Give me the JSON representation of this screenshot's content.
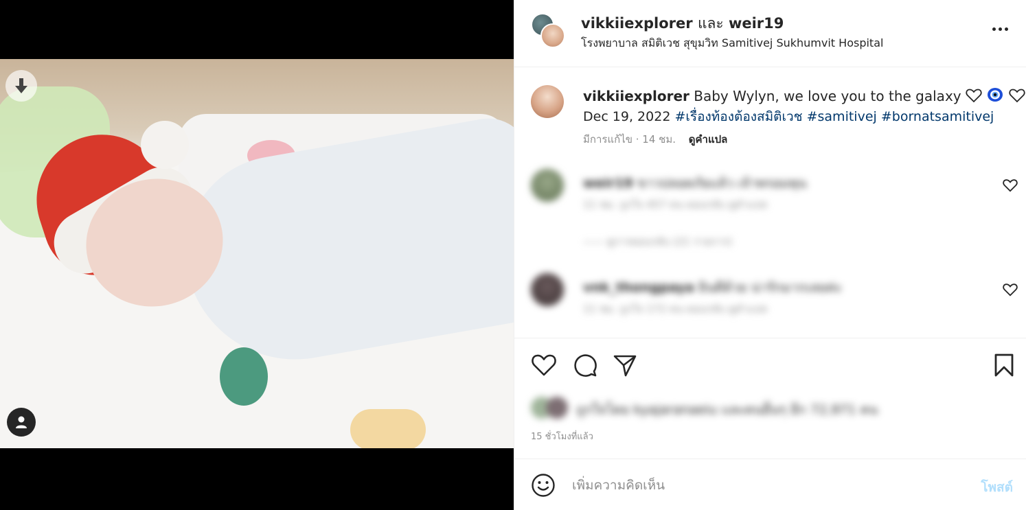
{
  "header": {
    "user1": "vikkiiexplorer",
    "joiner": "และ",
    "user2": "weir19",
    "location": "โรงพยาบาล สมิติเวช สุขุมวิท Samitivej Sukhumvit Hospital",
    "more_icon": "more-horizontal-icon"
  },
  "media": {
    "download_icon": "arrow-down-icon",
    "tagged_users_icon": "user-icon"
  },
  "caption": {
    "username": "vikkiiexplorer",
    "text": "Baby Wylyn, we love you to the galaxy",
    "emojis": [
      "white-heart",
      "blue-evil-eye",
      "white-heart"
    ],
    "date": "Dec 19, 2022",
    "hashtags": [
      "#เรื่องท้องต้องสมิติเวช",
      "#samitivej",
      "#bornatsamitivej"
    ],
    "edited": "มีการแก้ไข · 14 ชม.",
    "translate": "ดูคำแปล"
  },
  "comments": [
    {
      "username": "weir19",
      "text": "ขาวปลอดภัยแล้ว เจ้าพรอมพุน",
      "meta": "11 ชม.   ถูกใจ 457 คน   ตอบกลับ   ดูคำแปล"
    },
    {
      "username": "vnk_thongpaya",
      "text": "ยินดีด้วย น่ารักมากเลยค่ะ",
      "meta": "11 ชม.   ถูกใจ 172 คน   ตอบกลับ   ดูคำแปล"
    }
  ],
  "replies_text": "—— ดูการตอบกลับ (21 รายการ)",
  "likes_text": "ถูกใจโดย kyajaranaeiu และคนอื่นๆ อีก 72,971 คน",
  "time_ago": "15 ชั่วโมงที่แล้ว",
  "composer": {
    "placeholder": "เพิ่มความคิดเห็น",
    "post_label": "โพสต์"
  },
  "colors": {
    "link": "#00376b",
    "muted": "#8e8e8e",
    "post_disabled": "#b2dffc",
    "divider": "#efefef"
  }
}
